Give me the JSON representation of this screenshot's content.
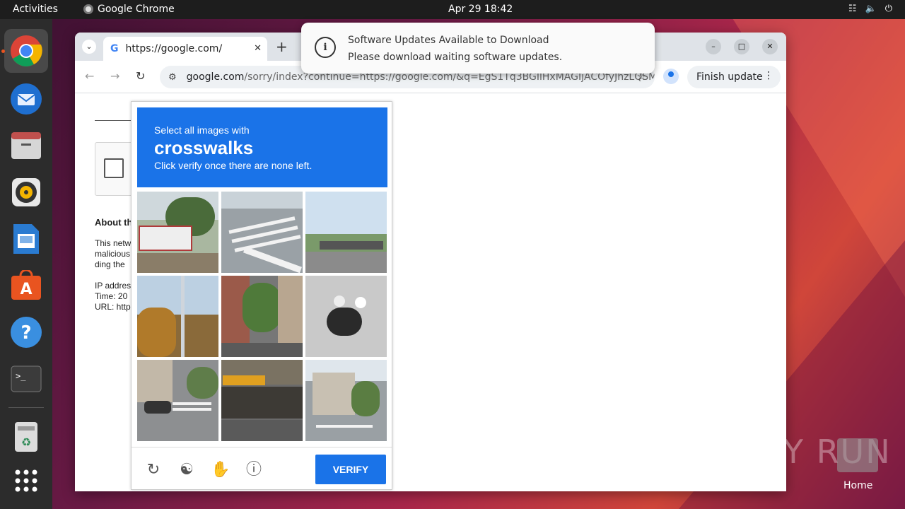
{
  "topbar": {
    "activities": "Activities",
    "app_name": "Google Chrome",
    "clock": "Apr 29  18:42"
  },
  "dock": {
    "apps": [
      "chrome-icon",
      "thunderbird-icon",
      "files-icon",
      "rhythmbox-icon",
      "writer-icon",
      "software-icon",
      "help-icon",
      "terminal-icon",
      "trash-icon",
      "app-grid-icon"
    ]
  },
  "browser": {
    "tab_title": "https://google.com/",
    "tab_favicon": "G",
    "url_host": "google.com",
    "url_rest": "/sorry/index?continue=https://google.com/&q=EgS1Tq3BGIlHxMAGIjACOfyJhzLQSM...",
    "finish_update": "Finish update"
  },
  "page": {
    "about_heading": "About th",
    "about_text": "This netw malicious ding the",
    "ip_text": "IP addres Time: 20 URL: http"
  },
  "captcha": {
    "line1": "Select all images with",
    "target": "crosswalks",
    "line3": "Click verify once there are none left.",
    "verify_label": "VERIFY",
    "accent_color": "#1a73e8"
  },
  "notification": {
    "title": "Software Updates Available to Download",
    "body": "Please download waiting software updates."
  },
  "desktop": {
    "watermark": "ANY RUN",
    "home_label": "Home"
  }
}
